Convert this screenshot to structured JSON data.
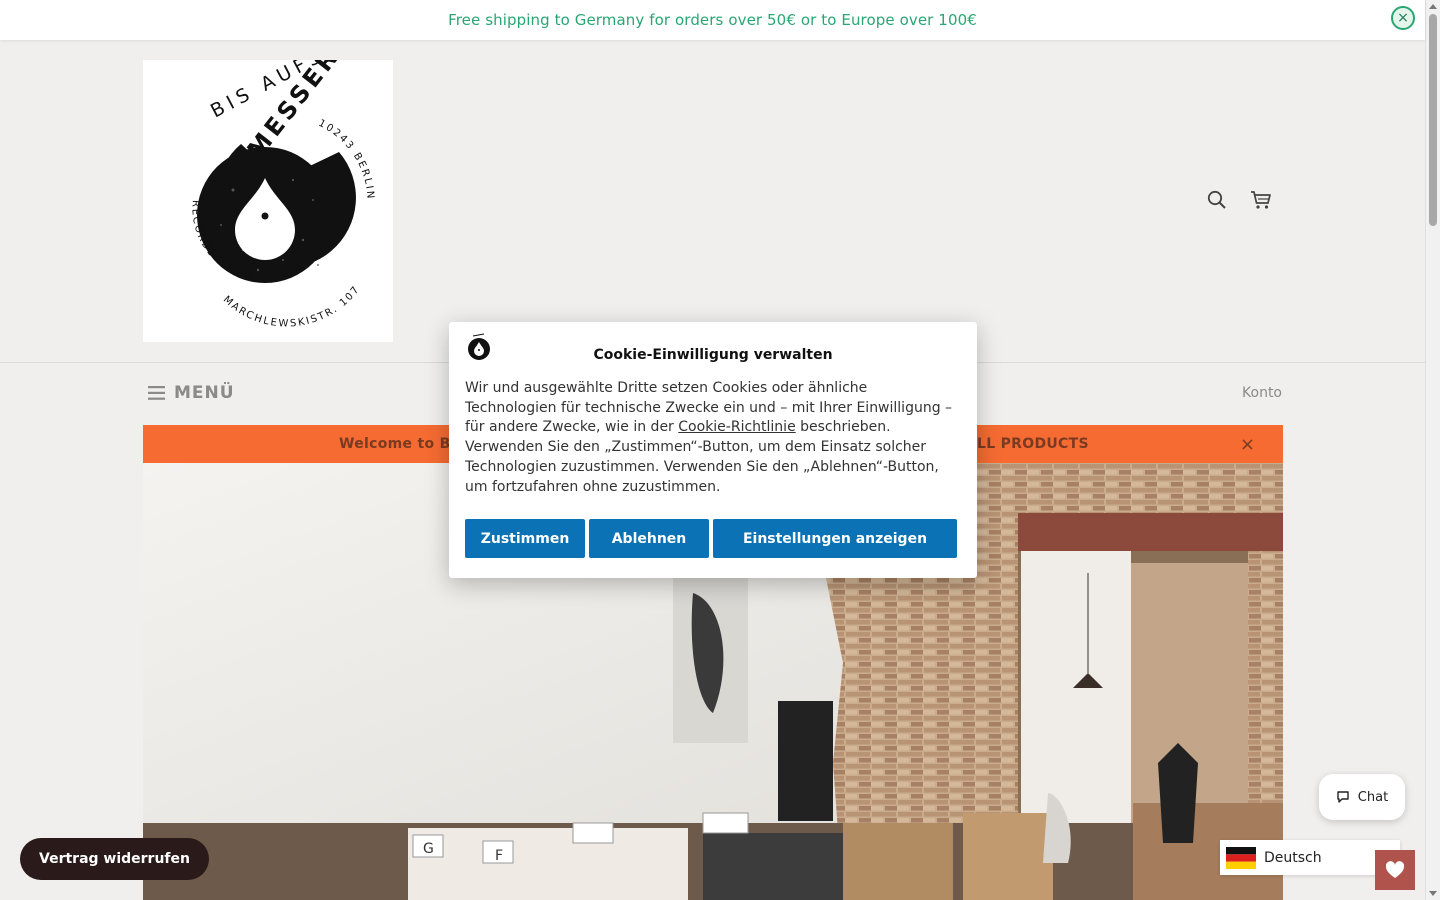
{
  "shipping_bar": {
    "text": "Free shipping to Germany for orders over 50€ or to Europe over 100€",
    "close_icon": "×"
  },
  "logo": {
    "top_text": "BIS AUFS",
    "brand": "MESSER",
    "left_ring": "RECORDSTORE & MAILORDER",
    "bottom_ring": "MARCHLEWSKISTR. 107",
    "right_ring": "10243 BERLIN"
  },
  "header": {
    "search_icon": "search-icon",
    "cart_icon": "cart-icon"
  },
  "nav": {
    "menu_label": "MENÜ",
    "account_label": "Konto"
  },
  "promo": {
    "text_left": "Welcome to Bi",
    "text_right": "LL PRODUCTS",
    "close": "×"
  },
  "cookie": {
    "title": "Cookie-Einwilligung verwalten",
    "body_1": "Wir und ausgewählte Dritte setzen Cookies oder ähnliche Technologien für technische Zwecke ein und – mit Ihrer Einwilligung – für andere Zwecke, wie in der ",
    "link": "Cookie-Richtlinie",
    "body_2": " beschrieben. Verwenden Sie den „Zustimmen“-Button, um dem Einsatz solcher Technologien zuzustimmen. Verwenden Sie den „Ablehnen“-Button, um fortzufahren ohne zuzustimmen.",
    "accept": "Zustimmen",
    "reject": "Ablehnen",
    "settings": "Einstellungen anzeigen"
  },
  "revoke_button": "Vertrag widerrufen",
  "chat": {
    "label": "Chat"
  },
  "language": {
    "label": "Deutsch"
  },
  "hero": {
    "crate_labels": [
      "G",
      "F"
    ]
  },
  "colors": {
    "shipping_text": "#2aa673",
    "promo_bg": "#f56b32",
    "primary_button": "#0b73b5",
    "wishlist": "#b0534c"
  }
}
